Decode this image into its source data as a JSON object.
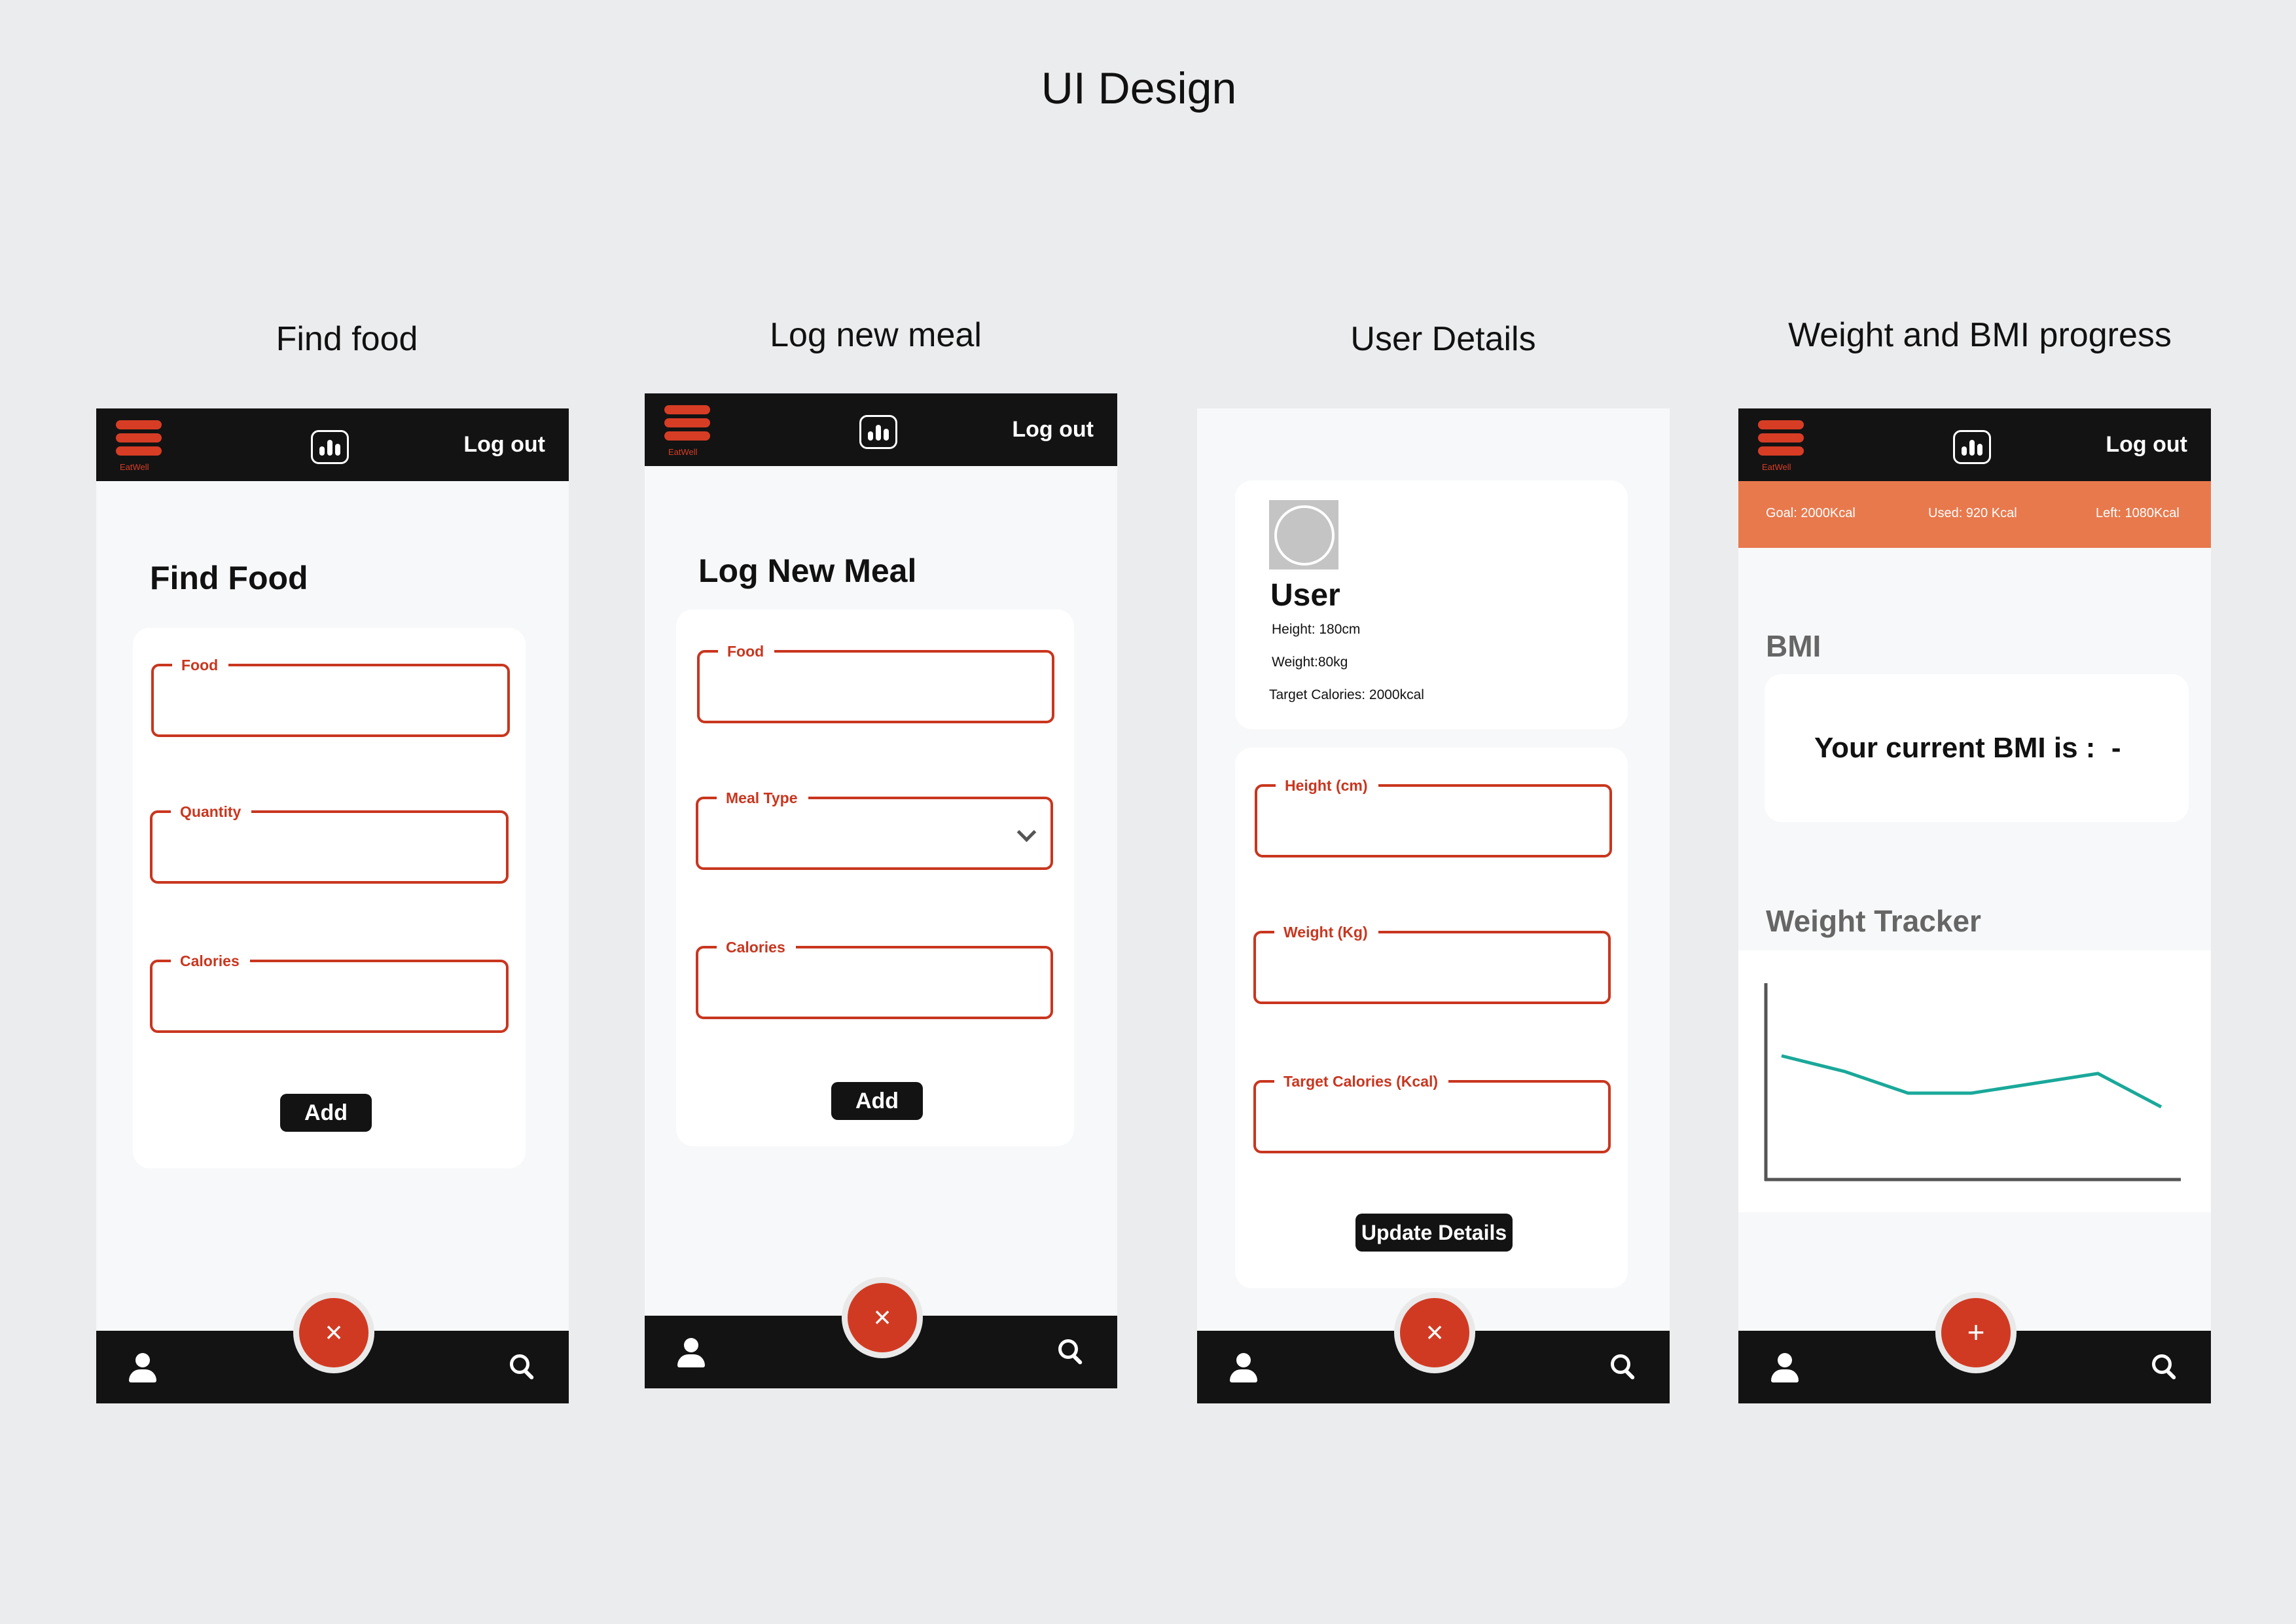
{
  "page": {
    "title": "UI Design"
  },
  "captions": [
    "Find food",
    "Log new meal",
    "User Details",
    "Weight and BMI progress"
  ],
  "brand": {
    "logo_text": "EatWell"
  },
  "topbar": {
    "logout_label": "Log out"
  },
  "find_food": {
    "heading": "Find Food",
    "fields": [
      "Food",
      "Quantity",
      "Calories"
    ],
    "add_label": "Add"
  },
  "log_meal": {
    "heading": "Log New Meal",
    "fields": [
      "Food",
      "Meal Type",
      "Calories"
    ],
    "add_label": "Add"
  },
  "user_details": {
    "name": "User",
    "height": "Height: 180cm",
    "weight": "Weight:80kg",
    "target": "Target Calories: 2000kcal",
    "fields": [
      "Height (cm)",
      "Weight (Kg)",
      "Target Calories (Kcal)"
    ],
    "update_label": "Update Details"
  },
  "progress": {
    "goal": "Goal: 2000Kcal",
    "used": "Used: 920 Kcal",
    "left": "Left: 1080Kcal",
    "bmi_heading": "BMI",
    "bmi_text": "Your current BMI is :  -",
    "weight_heading": "Weight Tracker"
  },
  "fab": {
    "close_symbol": "×",
    "add_symbol": "+"
  },
  "colors": {
    "accent": "#c9361f",
    "bar": "#131313",
    "goal_bar": "#e8794d",
    "line": "#1aa89a"
  },
  "chart_data": {
    "type": "line",
    "title": "",
    "xlabel": "",
    "ylabel": "",
    "series": [
      {
        "values": [
          6.3,
          5.5,
          4.4,
          4.4,
          4.9,
          5.4,
          3.7
        ]
      }
    ],
    "ylim": [
      0,
      10
    ],
    "grid": false
  }
}
